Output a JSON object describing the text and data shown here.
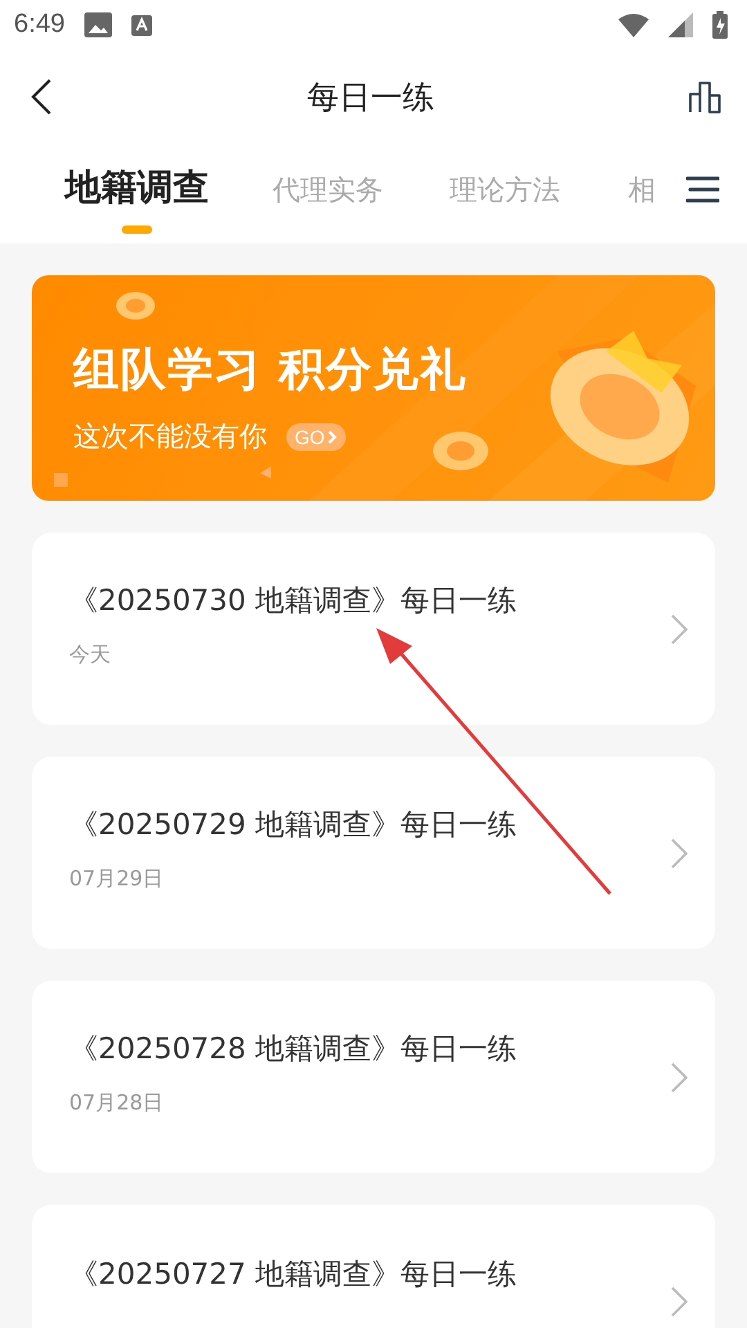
{
  "status_bar": {
    "time": "6:49"
  },
  "header": {
    "title": "每日一练"
  },
  "tabs": [
    {
      "label": "地籍调查",
      "selected": true
    },
    {
      "label": "代理实务",
      "selected": false
    },
    {
      "label": "理论方法",
      "selected": false
    },
    {
      "label": "相",
      "selected": false
    }
  ],
  "banner": {
    "headline": "组队学习 积分兑礼",
    "subline": "这次不能没有你",
    "cta": "GO"
  },
  "exercises": [
    {
      "title": "《20250730 地籍调查》每日一练",
      "date": "今天"
    },
    {
      "title": "《20250729 地籍调查》每日一练",
      "date": "07月29日"
    },
    {
      "title": "《20250728 地籍调查》每日一练",
      "date": "07月28日"
    },
    {
      "title": "《20250727 地籍调查》每日一练"
    }
  ]
}
